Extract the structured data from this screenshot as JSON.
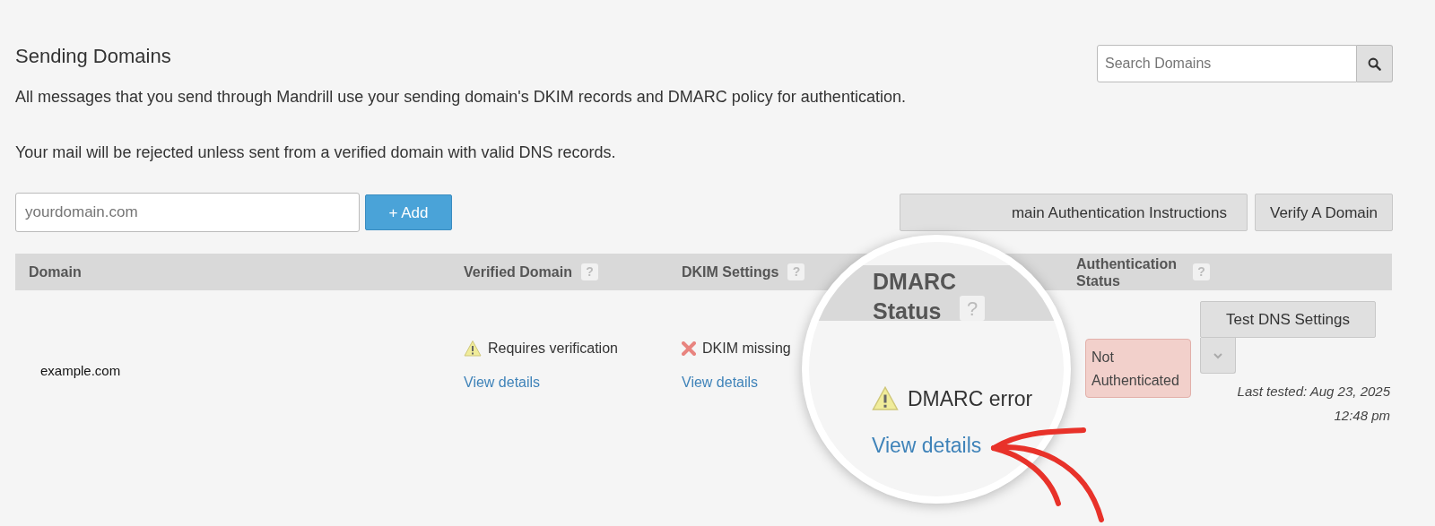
{
  "header": {
    "title": "Sending Domains",
    "search": {
      "placeholder": "Search Domains"
    }
  },
  "intro": [
    "All messages that you send through Mandrill use your sending domain's DKIM records and DMARC policy for authentication.",
    "Your mail will be rejected unless sent from a verified domain with valid DNS records."
  ],
  "add_form": {
    "placeholder": "yourdomain.com",
    "button": "+ Add"
  },
  "actions": [
    "main Authentication Instructions",
    "Verify A Domain"
  ],
  "table": {
    "columns": [
      {
        "label": "Domain"
      },
      {
        "label": "Verified Domain",
        "help": "?"
      },
      {
        "label": "DKIM Settings",
        "help": "?"
      },
      {
        "label": "Authentication Status",
        "help": "?"
      }
    ],
    "rows": [
      {
        "domain": "example.com",
        "verified": {
          "kind": "warning",
          "text": "Requires verification",
          "link": "View details"
        },
        "dkim": {
          "kind": "error",
          "text": "DKIM missing",
          "link": "View details"
        },
        "auth_status": {
          "kind": "error",
          "text": "Not Authenticated"
        },
        "test_button": "Test DNS Settings",
        "last_tested": [
          "Last tested: Aug 23, 2025",
          "12:48 pm"
        ]
      }
    ]
  },
  "magnifier": {
    "header": "DMARC Status",
    "help": "?",
    "status": {
      "kind": "warning",
      "text": "DMARC error"
    },
    "link": "View details"
  }
}
